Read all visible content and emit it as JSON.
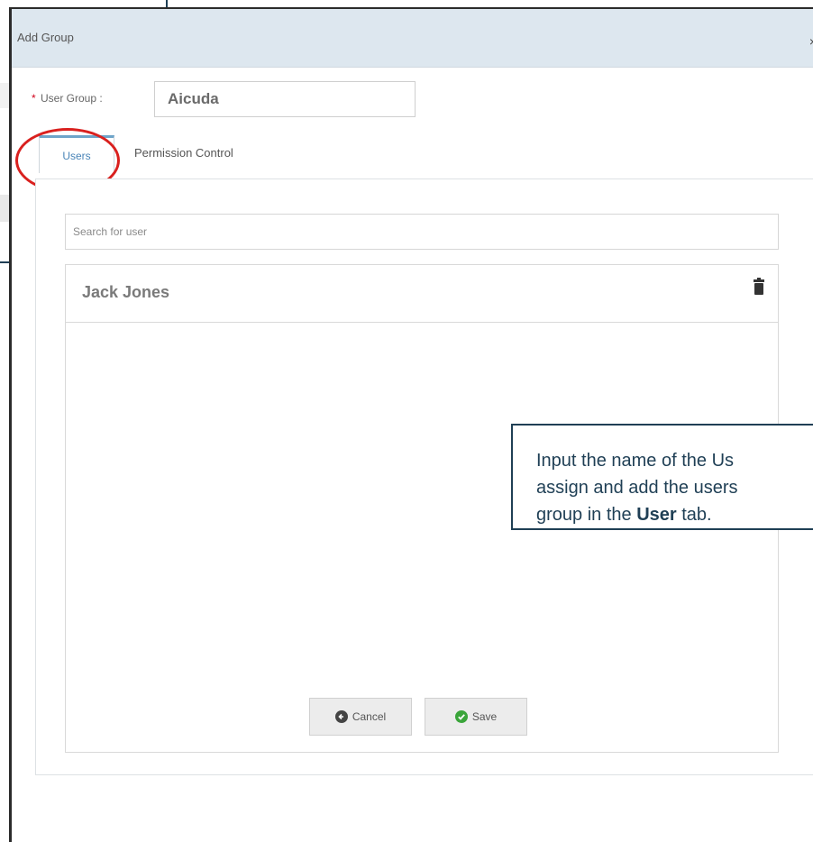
{
  "dialog": {
    "title": "Add Group",
    "close_glyph": "×"
  },
  "form": {
    "required_marker": "*",
    "user_group_label": "User Group :",
    "user_group_value": "Aicuda"
  },
  "tabs": [
    {
      "label": "Users",
      "active": true
    },
    {
      "label": "Permission Control",
      "active": false
    }
  ],
  "users_panel": {
    "search_placeholder": "Search for user",
    "users": [
      {
        "name": "Jack Jones",
        "action_icon": "trash-icon"
      }
    ]
  },
  "buttons": {
    "cancel_label": "Cancel",
    "save_label": "Save"
  },
  "callout": {
    "line1": "Input the name of the Us",
    "line2": "assign and add the users",
    "line3_pre": "group in the ",
    "line3_bold": "User",
    "line3_post": " tab."
  },
  "colors": {
    "highlight_circle": "#d9201e",
    "callout_border": "#1f3f55",
    "active_tab": "#4a85b8",
    "header_bg": "#dde7ef",
    "save_icon": "#3aa53a"
  }
}
